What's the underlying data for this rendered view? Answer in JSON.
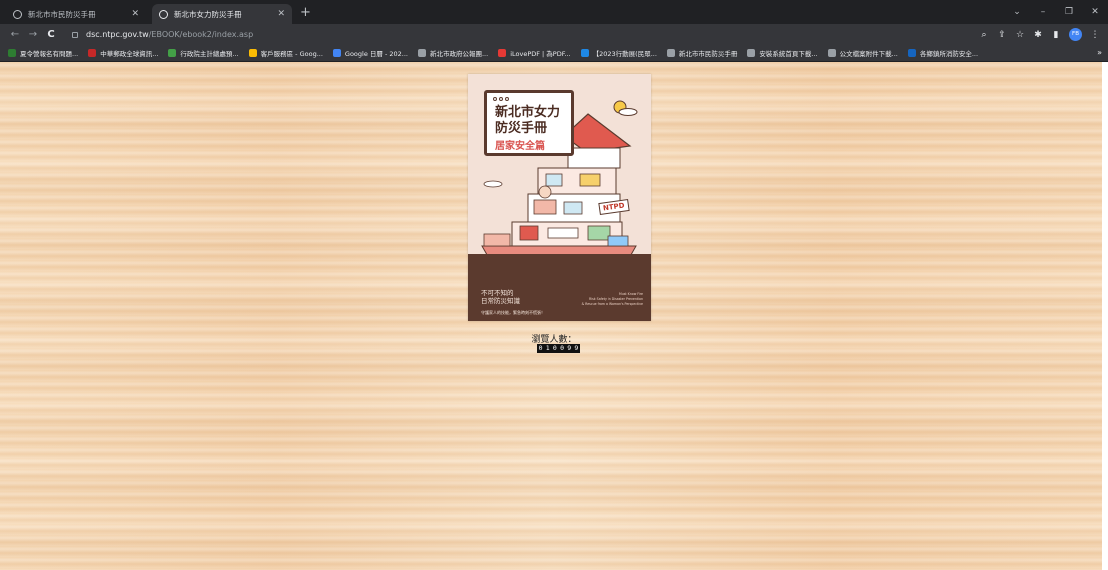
{
  "tabs": [
    {
      "title": "新北市市民防災手冊"
    },
    {
      "title": "新北市女力防災手冊"
    }
  ],
  "new_tab_label": "+",
  "window_controls": {
    "dropdown": "⌄",
    "minimize": "–",
    "restore": "❐",
    "close": "✕"
  },
  "address": {
    "host": "dsc.ntpc.gov.tw",
    "path": "/EBOOK/ebook2/index.asp"
  },
  "profile_initials": "FB",
  "bookmarks": [
    {
      "label": "夏令營報名有問題...",
      "color": "#2e7d32"
    },
    {
      "label": "中華郵政全球資訊...",
      "color": "#c62828"
    },
    {
      "label": "行政院主計總處預...",
      "color": "#43a047"
    },
    {
      "label": "客戶服務區 - Goog...",
      "color": "#fbbc04"
    },
    {
      "label": "Google 日曆 - 202...",
      "color": "#4285f4"
    },
    {
      "label": "新北市政府公報團...",
      "color": "#9aa0a6"
    },
    {
      "label": "iLovePDF | 為PDF...",
      "color": "#e53935"
    },
    {
      "label": "【2023行動展(民眾...",
      "color": "#1e88e5"
    },
    {
      "label": "新北市市民防災手冊",
      "color": "#9aa0a6"
    },
    {
      "label": "安裝系統首頁下載...",
      "color": "#9aa0a6"
    },
    {
      "label": "公文檔案附件下載...",
      "color": "#9aa0a6"
    },
    {
      "label": "各鄉鎮所消防安全...",
      "color": "#1565c0"
    }
  ],
  "bookmarks_more": "»",
  "cover": {
    "title": "新北市女力\n防災手冊",
    "subtitle": "居家安全篇",
    "badge": "NTPD",
    "lead": "不可不知的\n日常防災知識",
    "tagline": "守護家人的技能，緊急時刻不慌張！",
    "english": "Must Know Fire\nRisk Safety in Disaster Prevention\n& Rescue from a Woman's Perspective"
  },
  "counter": {
    "label": "瀏覽人數：",
    "digits": [
      "0",
      "1",
      "0",
      "0",
      "9",
      "9"
    ]
  }
}
